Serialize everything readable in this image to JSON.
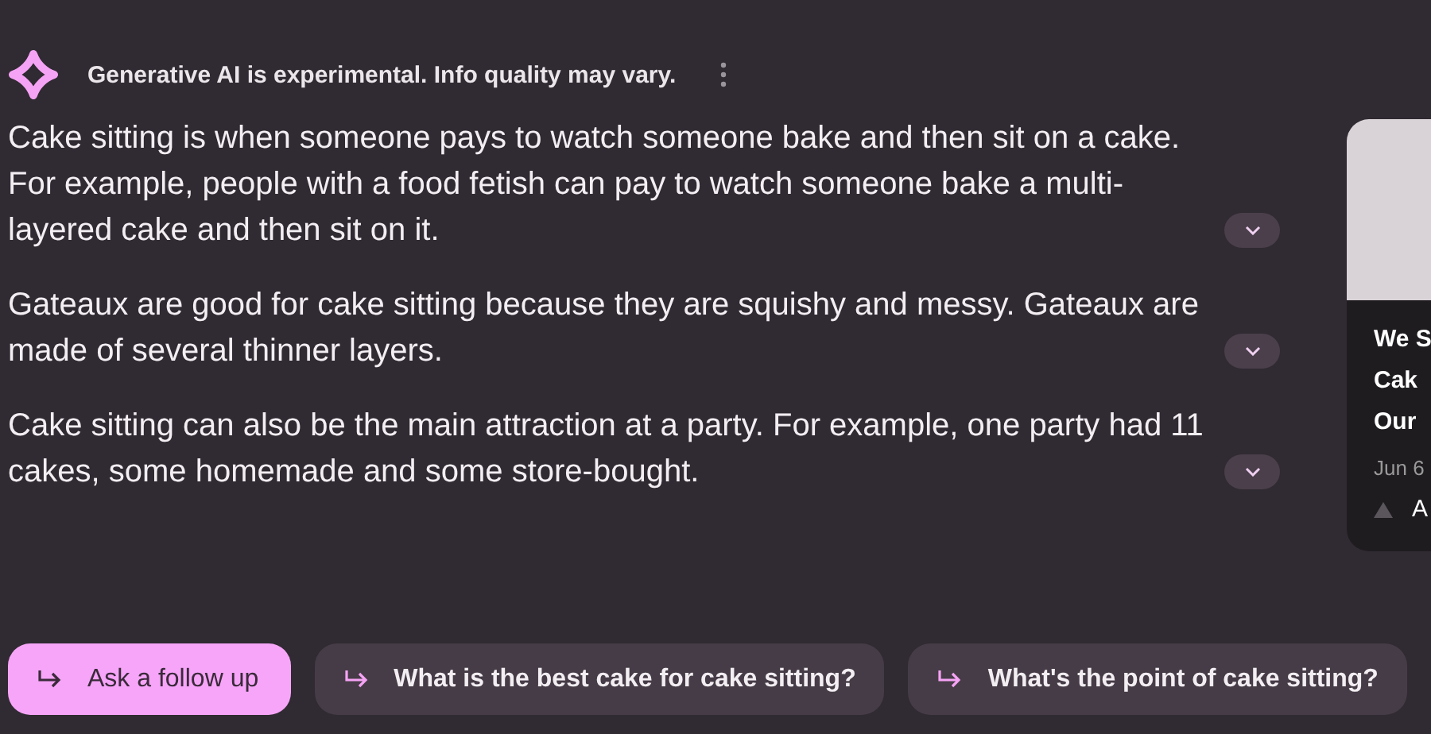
{
  "header": {
    "notice": "Generative AI is experimental. Info quality may vary."
  },
  "paragraphs": [
    "Cake sitting is when someone pays to watch someone bake and then sit on a cake. For example, people with a food fetish can pay to watch someone bake a multi-layered cake and then sit on it.",
    "Gateaux are good for cake sitting because they are squishy and messy. Gateaux are made of several thinner layers.",
    "Cake sitting can also be the main attraction at a party. For example, one party had 11 cakes, some homemade and some store-bought."
  ],
  "source_card": {
    "title_lines": [
      "We S",
      "Cak",
      "Our"
    ],
    "date": "Jun 6",
    "source": "A"
  },
  "chips": [
    {
      "label": "Ask a follow up",
      "kind": "primary"
    },
    {
      "label": "What is the best cake for cake sitting?",
      "kind": "suggestion"
    },
    {
      "label": "What's the point of cake sitting?",
      "kind": "suggestion"
    }
  ]
}
